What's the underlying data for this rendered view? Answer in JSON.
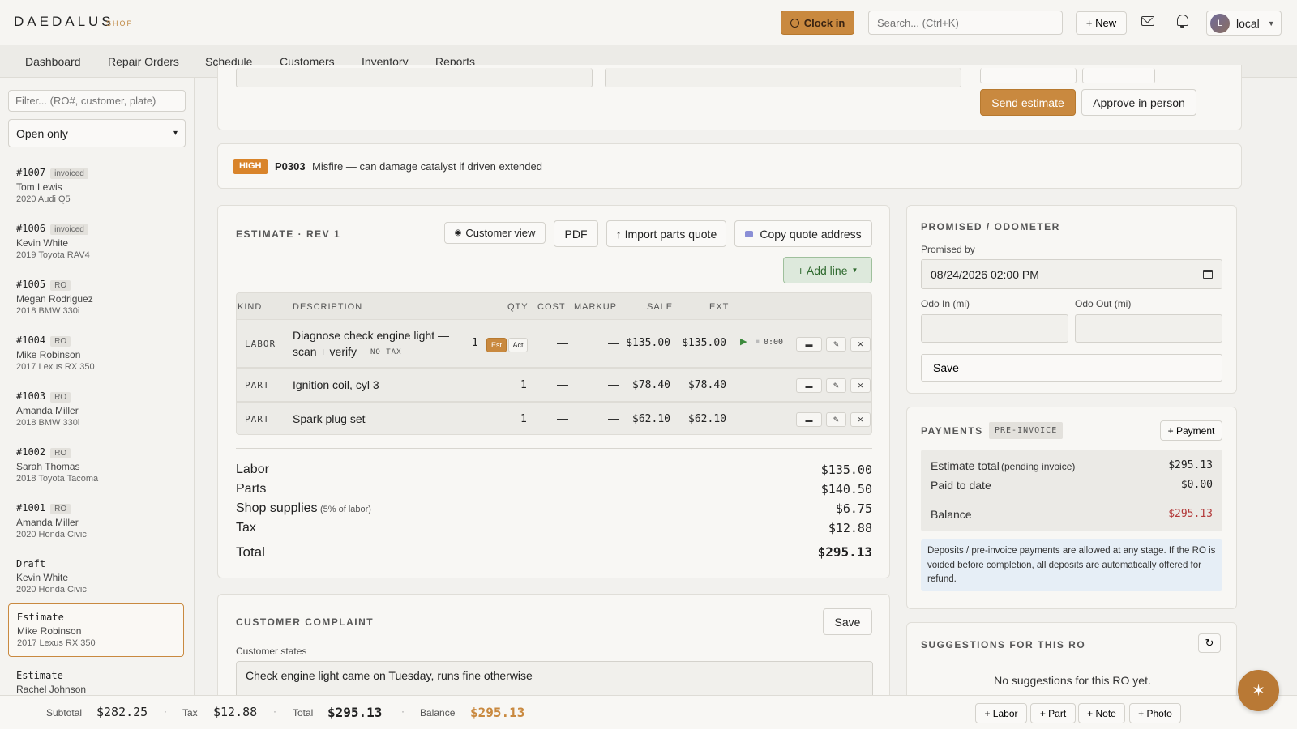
{
  "colors": {
    "accent": "#c9893f",
    "balance": "#c9893f",
    "badge_high": "#d9842a",
    "neg": "#b33a3a",
    "info_bg": "#e6eef6"
  },
  "brand": {
    "name": "DAEDALUS",
    "sub": "SHOP"
  },
  "topbar": {
    "clock_in": "Clock in",
    "search_placeholder": "Search... (Ctrl+K)",
    "new_label": "+ New",
    "user_initial": "L",
    "user_name": "local"
  },
  "nav": {
    "items": [
      "Dashboard",
      "Repair Orders",
      "Schedule",
      "Customers",
      "Inventory",
      "Reports"
    ]
  },
  "sidebar": {
    "filter_placeholder": "Filter... (RO#, customer, plate)",
    "status_filter": "Open only",
    "orders": [
      {
        "id": "#1007",
        "tag": "invoiced",
        "customer": "Tom Lewis",
        "vehicle": "2020 Audi Q5"
      },
      {
        "id": "#1006",
        "tag": "invoiced",
        "customer": "Kevin White",
        "vehicle": "2019 Toyota RAV4"
      },
      {
        "id": "#1005",
        "tag": "RO",
        "customer": "Megan Rodriguez",
        "vehicle": "2018 BMW 330i"
      },
      {
        "id": "#1004",
        "tag": "RO",
        "customer": "Mike Robinson",
        "vehicle": "2017 Lexus RX 350"
      },
      {
        "id": "#1003",
        "tag": "RO",
        "customer": "Amanda Miller",
        "vehicle": "2018 BMW 330i"
      },
      {
        "id": "#1002",
        "tag": "RO",
        "customer": "Sarah Thomas",
        "vehicle": "2018 Toyota Tacoma"
      },
      {
        "id": "#1001",
        "tag": "RO",
        "customer": "Amanda Miller",
        "vehicle": "2020 Honda Civic"
      },
      {
        "id": "Draft",
        "tag": "",
        "customer": "Kevin White",
        "vehicle": "2020 Honda Civic"
      },
      {
        "id": "Estimate",
        "tag": "",
        "customer": "Mike Robinson",
        "vehicle": "2017 Lexus RX 350"
      },
      {
        "id": "Estimate",
        "tag": "",
        "customer": "Rachel Johnson",
        "vehicle": ""
      }
    ]
  },
  "actions": {
    "send_estimate": "Send estimate",
    "approve_in_person": "Approve in person"
  },
  "dtc": {
    "severity": "HIGH",
    "code": "P0303",
    "description": "Misfire — can damage catalyst if driven extended"
  },
  "estimate": {
    "title": "ESTIMATE · REV 1",
    "customer_view": "Customer view",
    "pdf": "PDF",
    "import_parts": "↑ Import parts quote",
    "copy_quote": "Copy quote address",
    "add_line": "+ Add line",
    "columns": [
      "KIND",
      "DESCRIPTION",
      "QTY",
      "COST",
      "MARKUP",
      "SALE",
      "EXT"
    ],
    "lines": [
      {
        "kind": "LABOR",
        "desc1": "Diagnose check engine light —",
        "desc2": "scan + verify",
        "flag": "NO TAX",
        "qty": "1",
        "est": "Est",
        "act": "Act",
        "cost": "—",
        "markup": "—",
        "sale": "$135.00",
        "ext": "$135.00",
        "timer": "0:00"
      },
      {
        "kind": "PART",
        "desc1": "Ignition coil, cyl 3",
        "qty": "1",
        "cost": "—",
        "markup": "—",
        "sale": "$78.40",
        "ext": "$78.40"
      },
      {
        "kind": "PART",
        "desc1": "Spark plug set",
        "qty": "1",
        "cost": "—",
        "markup": "—",
        "sale": "$62.10",
        "ext": "$62.10"
      }
    ],
    "totals": {
      "labor_label": "Labor",
      "labor": "$135.00",
      "parts_label": "Parts",
      "parts": "$140.50",
      "supplies_label": "Shop supplies",
      "supplies_note": "(5% of labor)",
      "supplies": "$6.75",
      "tax_label": "Tax",
      "tax": "$12.88",
      "total_label": "Total",
      "total": "$295.13"
    }
  },
  "complaint": {
    "title": "CUSTOMER COMPLAINT",
    "save": "Save",
    "states_label": "Customer states",
    "text": "Check engine light came on Tuesday, runs fine otherwise"
  },
  "promised": {
    "title": "PROMISED / ODOMETER",
    "promised_label": "Promised by",
    "promised_value": "08/24/2026 02:00 PM",
    "odo_in_label": "Odo In (mi)",
    "odo_out_label": "Odo Out (mi)",
    "save": "Save"
  },
  "payments": {
    "title": "PAYMENTS",
    "badge": "PRE-INVOICE",
    "add": "+ Payment",
    "est_label": "Estimate total",
    "est_note": "(pending invoice)",
    "est": "$295.13",
    "paid_label": "Paid to date",
    "paid": "$0.00",
    "balance_label": "Balance",
    "balance": "$295.13",
    "note": "Deposits / pre-invoice payments are allowed at any stage. If the RO is voided before completion, all deposits are automatically offered for refund."
  },
  "suggestions": {
    "title": "SUGGESTIONS FOR THIS RO",
    "empty": "No suggestions for this RO yet."
  },
  "bottom": {
    "subtotal_label": "Subtotal",
    "subtotal": "$282.25",
    "tax_label": "Tax",
    "tax": "$12.88",
    "total_label": "Total",
    "total": "$295.13",
    "balance_label": "Balance",
    "balance": "$295.13",
    "labor": "+ Labor",
    "part": "+ Part",
    "note": "+ Note",
    "photo": "+ Photo"
  }
}
